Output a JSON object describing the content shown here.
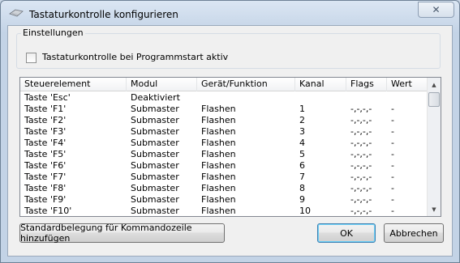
{
  "window": {
    "title": "Tastaturkontrolle konfigurieren",
    "close_glyph": "✕"
  },
  "settings": {
    "legend": "Einstellungen",
    "checkbox_label": "Tastaturkontrolle bei Programmstart aktiv",
    "checked": false
  },
  "table": {
    "columns": [
      "Steuerelement",
      "Modul",
      "Gerät/Funktion",
      "Kanal",
      "Flags",
      "Wert"
    ],
    "rows": [
      [
        "Taste 'Esc'",
        "Deaktiviert",
        "",
        "",
        "",
        ""
      ],
      [
        "Taste 'F1'",
        "Submaster",
        "Flashen",
        "1",
        "-,-,-,-",
        "-"
      ],
      [
        "Taste 'F2'",
        "Submaster",
        "Flashen",
        "2",
        "-,-,-,-",
        "-"
      ],
      [
        "Taste 'F3'",
        "Submaster",
        "Flashen",
        "3",
        "-,-,-,-",
        "-"
      ],
      [
        "Taste 'F4'",
        "Submaster",
        "Flashen",
        "4",
        "-,-,-,-",
        "-"
      ],
      [
        "Taste 'F5'",
        "Submaster",
        "Flashen",
        "5",
        "-,-,-,-",
        "-"
      ],
      [
        "Taste 'F6'",
        "Submaster",
        "Flashen",
        "6",
        "-,-,-,-",
        "-"
      ],
      [
        "Taste 'F7'",
        "Submaster",
        "Flashen",
        "7",
        "-,-,-,-",
        "-"
      ],
      [
        "Taste 'F8'",
        "Submaster",
        "Flashen",
        "8",
        "-,-,-,-",
        "-"
      ],
      [
        "Taste 'F9'",
        "Submaster",
        "Flashen",
        "9",
        "-,-,-,-",
        "-"
      ],
      [
        "Taste 'F10'",
        "Submaster",
        "Flashen",
        "10",
        "-,-,-,-",
        "-"
      ]
    ]
  },
  "buttons": {
    "standard": "Standardbelegung für Kommandozeile hinzufügen",
    "ok": "OK",
    "cancel": "Abbrechen"
  },
  "scrollbar": {
    "up_glyph": "▲",
    "down_glyph": "▼"
  }
}
